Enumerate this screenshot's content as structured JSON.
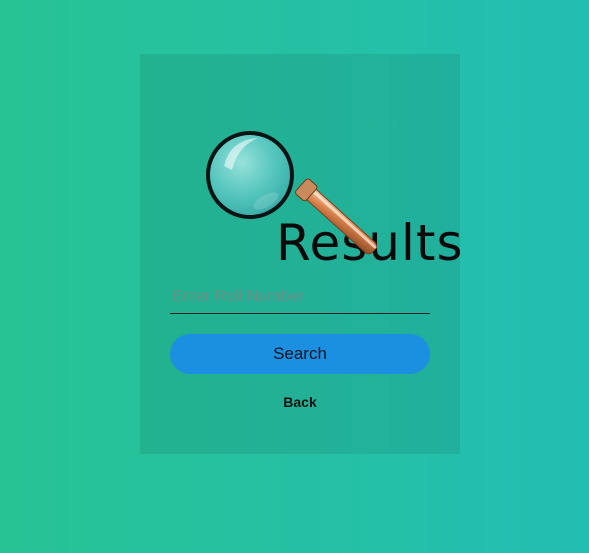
{
  "header": {
    "logo_text": "Results",
    "logo_icon": "magnifying-glass-icon"
  },
  "form": {
    "roll_placeholder": "Enter Roll Number",
    "roll_value": "",
    "search_label": "Search",
    "back_label": "Back"
  },
  "colors": {
    "background_start": "#27c394",
    "background_end": "#23beb2",
    "button": "#1b8fe0"
  }
}
